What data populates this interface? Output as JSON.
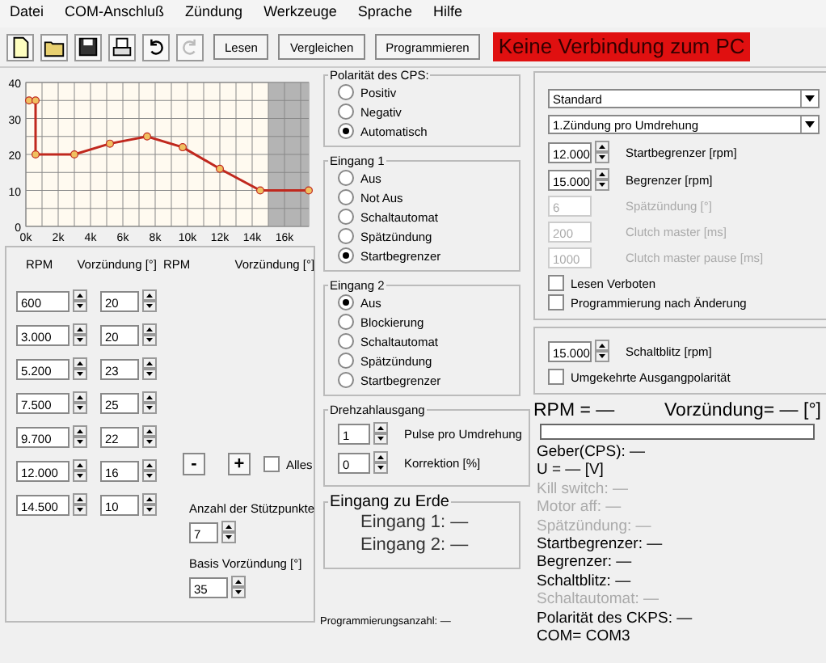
{
  "menu": [
    "Datei",
    "COM-Anschluß",
    "Zündung",
    "Werkzeuge",
    "Sprache",
    "Hilfe"
  ],
  "toolbar": {
    "icons": [
      {
        "kind": "new",
        "disabled": false
      },
      {
        "kind": "open",
        "disabled": false
      },
      {
        "kind": "save",
        "disabled": false
      },
      {
        "kind": "print",
        "disabled": false
      },
      {
        "kind": "undo",
        "disabled": false
      },
      {
        "kind": "redo",
        "disabled": true
      }
    ],
    "buttons": [
      "Lesen",
      "Vergleichen",
      "Programmieren"
    ]
  },
  "connection_status": "Keine Verbindung zum PC",
  "chart": {
    "chart_data": {
      "type": "line",
      "grid": true,
      "x": [
        0.2,
        0.6,
        0.6,
        3,
        5.2,
        7.5,
        9.7,
        12,
        14.5,
        17.5
      ],
      "series": [
        {
          "color": "#c0281e",
          "marker": "circle",
          "values": [
            35,
            35,
            20,
            20,
            23,
            25,
            22,
            16,
            10,
            10
          ]
        }
      ],
      "xlim": [
        0,
        17.5
      ],
      "ylim": [
        0,
        40
      ],
      "xticks": [
        {
          "value": 0,
          "label": "0k"
        },
        {
          "value": 2,
          "label": "2k"
        },
        {
          "value": 4,
          "label": "4k"
        },
        {
          "value": 6,
          "label": "6k"
        },
        {
          "value": 8,
          "label": "8k"
        },
        {
          "value": 10,
          "label": "10k"
        },
        {
          "value": 12,
          "label": "12k"
        },
        {
          "value": 14,
          "label": "14k"
        },
        {
          "value": 16,
          "label": "16k"
        }
      ],
      "yticks": [
        0,
        10,
        20,
        30,
        40
      ],
      "bands": [
        {
          "axis": "x",
          "from": 15,
          "to": 17.5,
          "color": "#b4b4b4"
        }
      ]
    }
  },
  "curve_table": {
    "headers": [
      "RPM",
      "Vorzündung [°]",
      "RPM",
      "Vorzündung [°]"
    ],
    "rows": [
      {
        "rpm": "600",
        "advance": "20"
      },
      {
        "rpm": "3.000",
        "advance": "20"
      },
      {
        "rpm": "5.200",
        "advance": "23"
      },
      {
        "rpm": "7.500",
        "advance": "25"
      },
      {
        "rpm": "9.700",
        "advance": "22"
      },
      {
        "rpm": "12.000",
        "advance": "16"
      },
      {
        "rpm": "14.500",
        "advance": "10"
      }
    ],
    "minus": "-",
    "plus": "+",
    "all_checkbox": {
      "label": "Alles",
      "checked": false
    },
    "points_label": "Anzahl der Stützpunkte",
    "points_value": "7",
    "base_label": "Basis Vorzündung [°]",
    "base_value": "35"
  },
  "polarity": {
    "title": "Polarität des CPS:",
    "options": [
      {
        "label": "Positiv",
        "selected": false
      },
      {
        "label": "Negativ",
        "selected": false
      },
      {
        "label": "Automatisch",
        "selected": true
      }
    ]
  },
  "input1": {
    "title": "Eingang 1",
    "options": [
      {
        "label": "Aus",
        "selected": false
      },
      {
        "label": "Not Aus",
        "selected": false
      },
      {
        "label": "Schaltautomat",
        "selected": false
      },
      {
        "label": "Spätzündung",
        "selected": false
      },
      {
        "label": "Startbegrenzer",
        "selected": true
      }
    ]
  },
  "input2": {
    "title": "Eingang 2",
    "options": [
      {
        "label": "Aus",
        "selected": true
      },
      {
        "label": "Blockierung",
        "selected": false
      },
      {
        "label": "Schaltautomat",
        "selected": false
      },
      {
        "label": "Spätzündung",
        "selected": false
      },
      {
        "label": "Startbegrenzer",
        "selected": false
      }
    ]
  },
  "speed_output": {
    "title": "Drehzahlausgang",
    "fields": [
      {
        "value": "1",
        "label": "Pulse pro Umdrehung"
      },
      {
        "value": "0",
        "label": "Korrektion [%]"
      }
    ]
  },
  "ground_input": {
    "title": "Eingang zu Erde",
    "lines": [
      "Eingang 1: —",
      "Eingang 2: —"
    ]
  },
  "program_count": "Programmierungsanzahl: —",
  "settings": {
    "selects": [
      "Standard",
      "1.Zündung pro Umdrehung"
    ],
    "fields": [
      {
        "kind": "spinner",
        "value": "12.000",
        "label": "Startbegrenzer [rpm]",
        "disabled": false
      },
      {
        "kind": "spinner",
        "value": "15.000",
        "label": "Begrenzer [rpm]",
        "disabled": false
      },
      {
        "kind": "text",
        "value": "6",
        "label": "Spätzündung [°]",
        "disabled": true
      },
      {
        "kind": "text",
        "value": "200",
        "label": "Clutch master [ms]",
        "disabled": true
      },
      {
        "kind": "text",
        "value": "1000",
        "label": "Clutch master pause [ms]",
        "disabled": true
      }
    ],
    "checkboxes": [
      {
        "label": "Lesen Verboten",
        "checked": false
      },
      {
        "label": "Programmierung nach Änderung",
        "checked": false
      }
    ]
  },
  "shift_light": {
    "value": "15.000",
    "label": "Schaltblitz [rpm]",
    "checkbox": {
      "label": "Umgekehrte Ausgangpolarität",
      "checked": false
    }
  },
  "live": {
    "rpm": "RPM = —",
    "advance": "Vorzündung= — [°]",
    "level": 0,
    "lines": [
      {
        "text": "Geber(CPS): —",
        "disabled": false
      },
      {
        "text": "U = — [V]",
        "disabled": false
      },
      {
        "text": "Kill switch: —",
        "disabled": true
      },
      {
        "text": "Motor aff: —",
        "disabled": true
      },
      {
        "text": "Spätzündung: —",
        "disabled": true
      },
      {
        "text": "Startbegrenzer: —",
        "disabled": false
      },
      {
        "text": "Begrenzer: —",
        "disabled": false
      },
      {
        "text": "Schaltblitz: —",
        "disabled": false
      },
      {
        "text": "Schaltautomat: —",
        "disabled": true
      },
      {
        "text": "Polarität des CKPS: —",
        "disabled": false
      },
      {
        "text": "COM= COM3",
        "disabled": false
      }
    ]
  }
}
